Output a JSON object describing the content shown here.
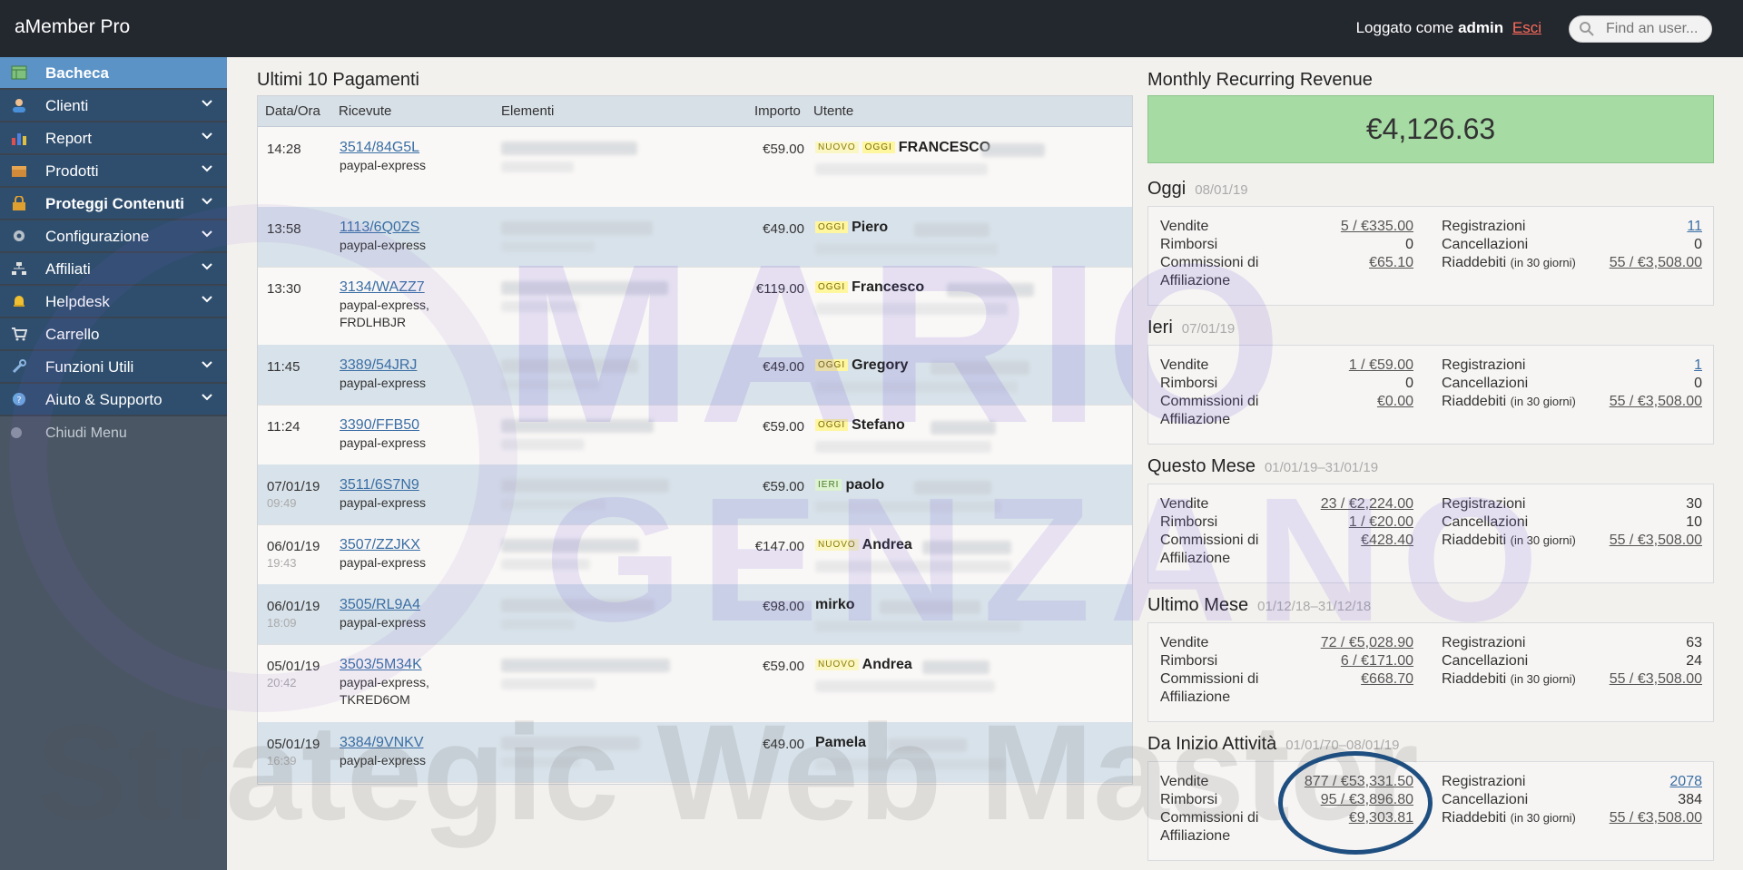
{
  "topbar": {
    "brand": "aMember Pro",
    "login_prefix": "Loggato come",
    "login_user": "admin",
    "logout": "Esci",
    "search_placeholder": "Find an user..."
  },
  "sidebar": {
    "items": [
      {
        "label": "Bacheca",
        "icon": "dashboard-icon"
      },
      {
        "label": "Clienti",
        "icon": "user-icon"
      },
      {
        "label": "Report",
        "icon": "chart-icon"
      },
      {
        "label": "Prodotti",
        "icon": "box-icon"
      },
      {
        "label": "Proteggi Contenuti",
        "icon": "lock-icon"
      },
      {
        "label": "Configurazione",
        "icon": "gear-icon"
      },
      {
        "label": "Affiliati",
        "icon": "sitemap-icon"
      },
      {
        "label": "Helpdesk",
        "icon": "bell-icon"
      },
      {
        "label": "Carrello",
        "icon": "cart-icon"
      },
      {
        "label": "Funzioni Utili",
        "icon": "wrench-icon"
      },
      {
        "label": "Aiuto & Supporto",
        "icon": "help-icon"
      }
    ],
    "close": "Chiudi Menu"
  },
  "payments": {
    "title": "Ultimi 10 Pagamenti",
    "headers": {
      "date": "Data/Ora",
      "receipt": "Ricevute",
      "items": "Elementi",
      "amount": "Importo",
      "user": "Utente"
    },
    "rows": [
      {
        "time": "14:28",
        "sub": "",
        "receipt": "3514/84G5L",
        "method": "paypal-express",
        "extra": "",
        "amount": "€59.00",
        "badges": [
          "NUOVO",
          "OGGI"
        ],
        "user": "FRANCESCO"
      },
      {
        "time": "13:58",
        "sub": "",
        "receipt": "1113/6Q0ZS",
        "method": "paypal-express",
        "extra": "",
        "amount": "€49.00",
        "badges": [
          "OGGI"
        ],
        "user": "Piero"
      },
      {
        "time": "13:30",
        "sub": "",
        "receipt": "3134/WAZZ7",
        "method": "paypal-express,",
        "extra": "FRDLHBJR",
        "amount": "€119.00",
        "badges": [
          "OGGI"
        ],
        "user": "Francesco"
      },
      {
        "time": "11:45",
        "sub": "",
        "receipt": "3389/54JRJ",
        "method": "paypal-express",
        "extra": "",
        "amount": "€49.00",
        "badges": [
          "OGGI"
        ],
        "user": "Gregory"
      },
      {
        "time": "11:24",
        "sub": "",
        "receipt": "3390/FFB50",
        "method": "paypal-express",
        "extra": "",
        "amount": "€59.00",
        "badges": [
          "OGGI"
        ],
        "user": "Stefano"
      },
      {
        "time": "07/01/19",
        "sub": "09:49",
        "receipt": "3511/6S7N9",
        "method": "paypal-express",
        "extra": "",
        "amount": "€59.00",
        "badges": [
          "IERI"
        ],
        "user": "paolo"
      },
      {
        "time": "06/01/19",
        "sub": "19:43",
        "receipt": "3507/ZZJKX",
        "method": "paypal-express",
        "extra": "",
        "amount": "€147.00",
        "badges": [
          "NUOVO"
        ],
        "user": "Andrea"
      },
      {
        "time": "06/01/19",
        "sub": "18:09",
        "receipt": "3505/RL9A4",
        "method": "paypal-express",
        "extra": "",
        "amount": "€98.00",
        "badges": [],
        "user": "mirko"
      },
      {
        "time": "05/01/19",
        "sub": "20:42",
        "receipt": "3503/5M34K",
        "method": "paypal-express,",
        "extra": "TKRED6OM",
        "amount": "€59.00",
        "badges": [
          "NUOVO"
        ],
        "user": "Andrea"
      },
      {
        "time": "05/01/19",
        "sub": "16:39",
        "receipt": "3384/9VNKV",
        "method": "paypal-express",
        "extra": "",
        "amount": "€49.00",
        "badges": [],
        "user": "Pamela"
      }
    ]
  },
  "mrr": {
    "title": "Monthly Recurring Revenue",
    "value": "€4,126.63"
  },
  "labels": {
    "sales": "Vendite",
    "refunds": "Rimborsi",
    "comm1": "Commissioni di",
    "comm2": "Affiliazione",
    "signups": "Registrazioni",
    "cancels": "Cancellazioni",
    "rebills": "Riaddebiti",
    "rebills_note": "(in 30 giorni)"
  },
  "stats": [
    {
      "title": "Oggi",
      "date": "08/01/19",
      "sales": "5 / €335.00",
      "refunds": "0",
      "commissions": "€65.10",
      "signups": "11",
      "cancels": "0",
      "rebills": "55 / €3,508.00"
    },
    {
      "title": "Ieri",
      "date": "07/01/19",
      "sales": "1 / €59.00",
      "refunds": "0",
      "commissions": "€0.00",
      "signups": "1",
      "cancels": "0",
      "rebills": "55 / €3,508.00"
    },
    {
      "title": "Questo Mese",
      "date": "01/01/19–31/01/19",
      "sales": "23 / €2,224.00",
      "refunds": "1 / €20.00",
      "commissions": "€428.40",
      "signups": "30",
      "cancels": "10",
      "rebills": "55 / €3,508.00"
    },
    {
      "title": "Ultimo Mese",
      "date": "01/12/18–31/12/18",
      "sales": "72 / €5,028.90",
      "refunds": "6 / €171.00",
      "commissions": "€668.70",
      "signups": "63",
      "cancels": "24",
      "rebills": "55 / €3,508.00"
    },
    {
      "title": "Da Inizio Attività",
      "date": "01/01/70–08/01/19",
      "sales": "877 / €53,331.50",
      "refunds": "95 / €3,896.80",
      "commissions": "€9,303.81",
      "signups": "2078",
      "cancels": "384",
      "rebills": "55 / €3,508.00"
    }
  ],
  "watermark": {
    "line1": "MARIO",
    "line2": "GENZANO",
    "line3": "Strategic Web Master"
  },
  "colors": {
    "topbar": "#23272e",
    "sidebar": "#2f4e6e",
    "active": "#5c93c6",
    "mrr": "#a6dba4",
    "link": "#3a6ea5"
  }
}
